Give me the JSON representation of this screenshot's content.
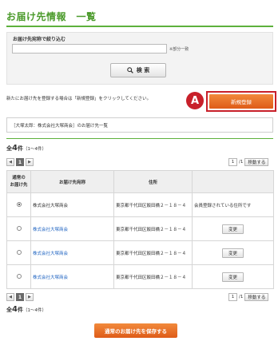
{
  "page": {
    "title": "お届け先情報　一覧"
  },
  "filter": {
    "label": "お届け先宛称で絞り込む",
    "input_value": "",
    "note": "※部分一致",
    "search_button": "検 索"
  },
  "new_entry": {
    "instruction": "新たにお届け先を登録する場合は「新規登録」をクリックしてください。",
    "badge": "A",
    "button": "新規登録"
  },
  "user_list_title": "［大塚太郎：株式会社大塚商会］のお届け先一覧",
  "summary": {
    "prefix": "全",
    "count": "4",
    "suffix": "件",
    "range": "（1～4件）"
  },
  "pager": {
    "prev": "◀",
    "current": "1",
    "next": "▶",
    "page_value": "1",
    "total": "/1",
    "go_button": "移動する"
  },
  "table": {
    "headers": [
      "通常の\nお届け先",
      "お届け先宛称",
      "住所",
      ""
    ],
    "rows": [
      {
        "selected": true,
        "name": "株式会社大塚商会",
        "is_link": false,
        "address": "東京都千代田区飯田橋２－１８－４",
        "action": "会員登録されている住所です",
        "action_type": "note"
      },
      {
        "selected": false,
        "name": "株式会社大塚商会",
        "is_link": true,
        "address": "東京都千代田区飯田橋２－１８－４",
        "action": "変更",
        "action_type": "button"
      },
      {
        "selected": false,
        "name": "株式会社大塚商会",
        "is_link": true,
        "address": "東京都千代田区飯田橋２－１８－４",
        "action": "変更",
        "action_type": "button"
      },
      {
        "selected": false,
        "name": "株式会社大塚商会",
        "is_link": true,
        "address": "東京都千代田区飯田橋２－１８－４",
        "action": "変更",
        "action_type": "button"
      }
    ]
  },
  "save_button": "通常のお届け先を保存する",
  "colors": {
    "accent_green": "#5db13c",
    "title_green": "#4a9a2a",
    "orange": "#de5b18",
    "annotation_red": "#c8202a",
    "link_blue": "#2366c2"
  },
  "icons": {
    "search": "magnifier-icon"
  }
}
